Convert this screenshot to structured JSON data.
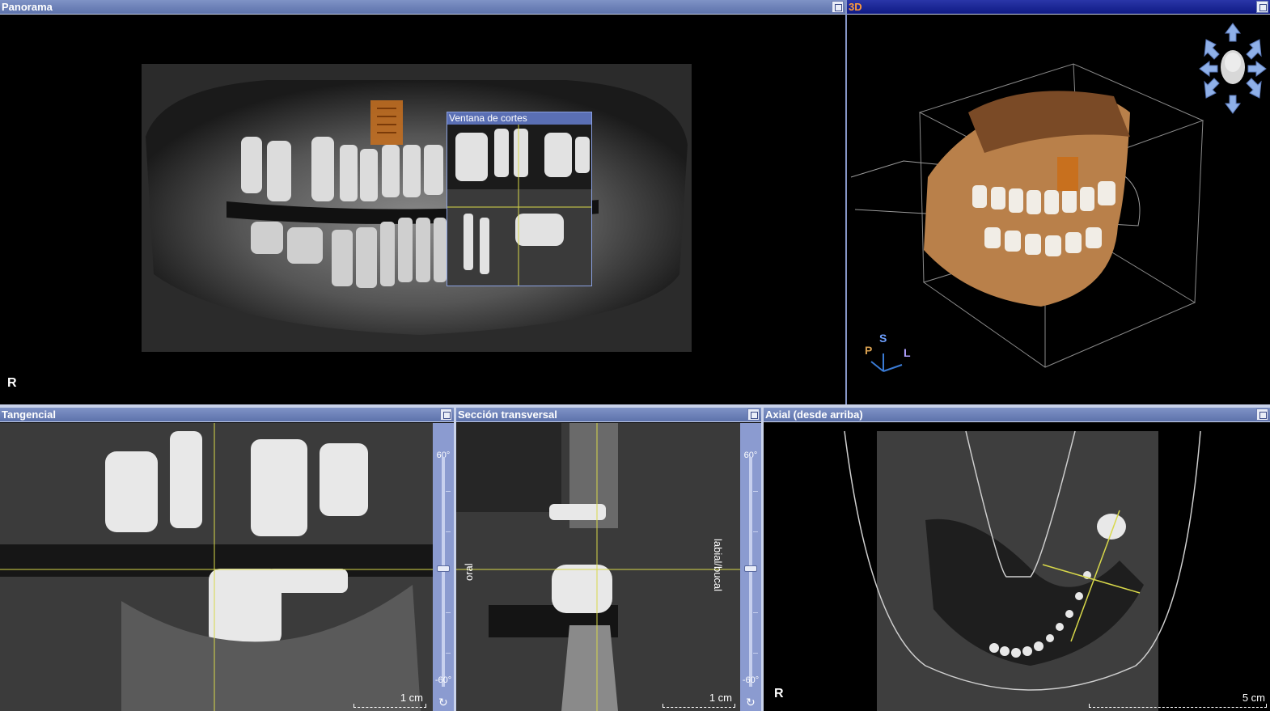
{
  "panes": {
    "panorama": {
      "title": "Panorama",
      "orientation": "R"
    },
    "view3d": {
      "title": "3D",
      "axes": {
        "p": "P",
        "s": "S",
        "l": "L"
      }
    },
    "ventana": {
      "title": "Ventana de cortes"
    },
    "tangencial": {
      "title": "Tangencial",
      "angle_top": "60°",
      "angle_bottom": "-60°",
      "scale": "1 cm"
    },
    "seccion": {
      "title": "Sección transversal",
      "angle_top": "60°",
      "angle_bottom": "-60°",
      "scale": "1 cm",
      "left_label": "oral",
      "right_label": "labial/bucal"
    },
    "axial": {
      "title": "Axial (desde arriba)",
      "orientation": "R",
      "scale": "5 cm"
    }
  },
  "colors": {
    "titlebar": "#6b80bb",
    "titlebar_active": "#1a268f",
    "accent_3d": "#ff9a3c",
    "crosshair": "#d8d84a",
    "implant": "#c8701e"
  },
  "icons": {
    "maximize": "maximize-icon",
    "rotate": "rotate-icon",
    "head_navigator": "head-navigator-icon"
  }
}
